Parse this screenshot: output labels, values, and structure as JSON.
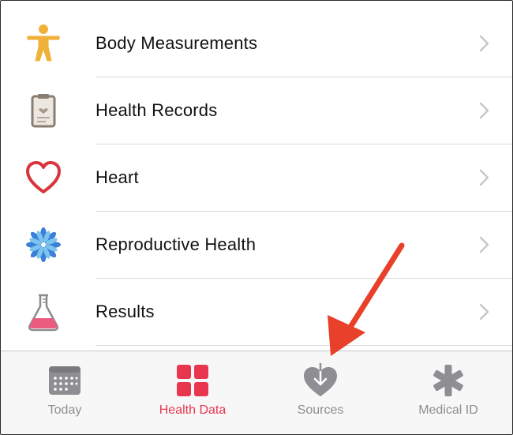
{
  "list": {
    "items": [
      {
        "label": "Body Measurements",
        "icon": "person-icon"
      },
      {
        "label": "Health Records",
        "icon": "clipboard-icon"
      },
      {
        "label": "Heart",
        "icon": "heart-icon"
      },
      {
        "label": "Reproductive Health",
        "icon": "flower-icon"
      },
      {
        "label": "Results",
        "icon": "flask-icon"
      }
    ]
  },
  "tabbar": {
    "tabs": [
      {
        "label": "Today",
        "icon": "calendar-icon",
        "active": false
      },
      {
        "label": "Health Data",
        "icon": "grid-icon",
        "active": true
      },
      {
        "label": "Sources",
        "icon": "sources-heart-icon",
        "active": false
      },
      {
        "label": "Medical ID",
        "icon": "asterisk-icon",
        "active": false
      }
    ]
  },
  "colors": {
    "accent": "#e8364e",
    "tab_inactive": "#8e8e93",
    "arrow": "#e8402a",
    "body_icon": "#f0b13a",
    "heart_icon": "#d9353d"
  }
}
